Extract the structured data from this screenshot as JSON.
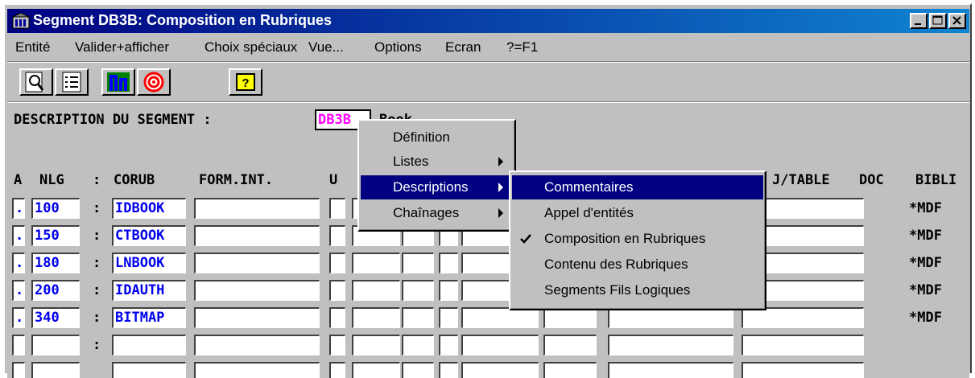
{
  "window": {
    "title": "Segment DB3B: Composition en Rubriques"
  },
  "menu": [
    {
      "label": "Entité"
    },
    {
      "label": "Valider+afficher"
    },
    {
      "label": "Choix spéciaux"
    },
    {
      "label": "Vue..."
    },
    {
      "label": "Options"
    },
    {
      "label": "Ecran"
    },
    {
      "label": "?=F1"
    }
  ],
  "toolbar": {
    "buttons": [
      "search-doc-icon",
      "list-icon",
      "graph-icon",
      "target-icon",
      "help-icon"
    ],
    "help_label": "?"
  },
  "screen": {
    "description_label": "DESCRIPTION DU SEGMENT :",
    "segment_code": "DB3B",
    "segment_name": "Book",
    "headers": {
      "a": "A",
      "nlg": "NLG",
      "colon": ":",
      "corub": "CORUB",
      "formint": "FORM.INT.",
      "u": "U",
      "table": "J/TABLE",
      "doc": "DOC",
      "bibli": "BIBLI"
    },
    "rows": [
      {
        "a": ".",
        "nlg": "100",
        "colon": ":",
        "corub": "IDBOOK",
        "bibli": "*MDF"
      },
      {
        "a": ".",
        "nlg": "150",
        "colon": ":",
        "corub": "CTBOOK",
        "bibli": "*MDF"
      },
      {
        "a": ".",
        "nlg": "180",
        "colon": ":",
        "corub": "LNBOOK",
        "bibli": "*MDF"
      },
      {
        "a": ".",
        "nlg": "200",
        "colon": ":",
        "corub": "IDAUTH",
        "bibli": "*MDF"
      },
      {
        "a": ".",
        "nlg": "340",
        "colon": ":",
        "corub": "BITMAP",
        "bibli": "*MDF"
      },
      {
        "a": "",
        "nlg": "",
        "colon": ":",
        "corub": "",
        "bibli": ""
      }
    ]
  },
  "context_menu": {
    "items": [
      {
        "label": "Définition",
        "has_submenu": false
      },
      {
        "label": "Listes",
        "has_submenu": true
      },
      {
        "label": "Descriptions",
        "has_submenu": true,
        "selected": true
      },
      {
        "label": "Chaînages",
        "has_submenu": true
      }
    ]
  },
  "submenu": {
    "items": [
      {
        "label": "Commentaires",
        "selected": true,
        "checked": false
      },
      {
        "label": "Appel d'entités",
        "checked": false
      },
      {
        "label": "Composition en Rubriques",
        "checked": true
      },
      {
        "label": "Contenu des Rubriques",
        "checked": false
      },
      {
        "label": "Segments Fils Logiques",
        "checked": false
      }
    ]
  },
  "colors": {
    "title_bar": "#000080",
    "field_text": "#0000ee",
    "segment_code": "#ff00ff",
    "selection": "#000080"
  }
}
